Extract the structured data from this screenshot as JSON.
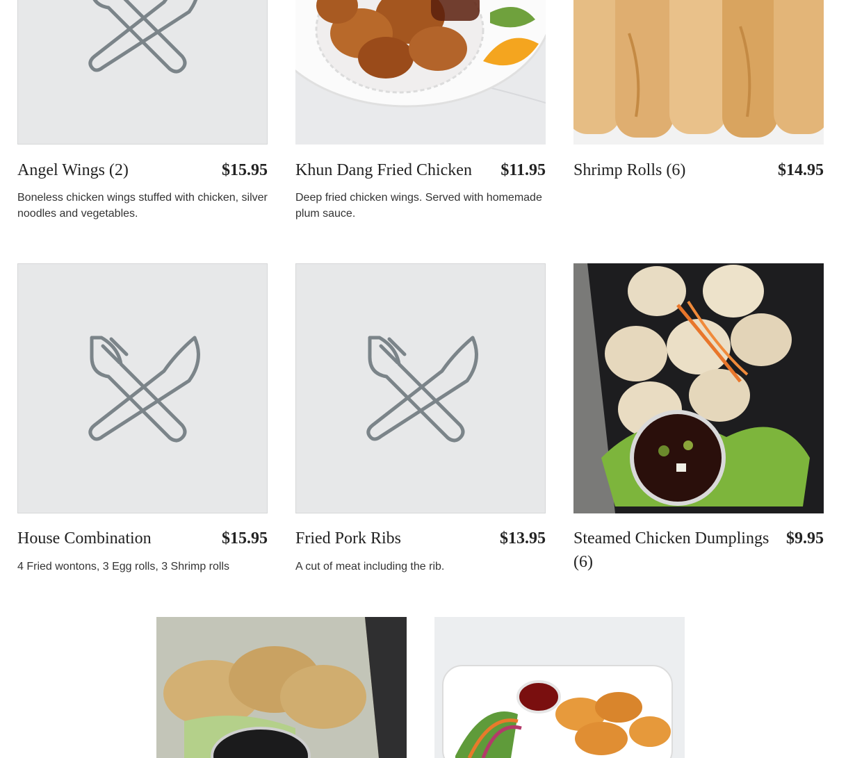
{
  "colors": {
    "placeholder_bg": "#e7e8e9",
    "utensils_icon": "#7b8489",
    "text": "#222222"
  },
  "items": [
    {
      "name": "Angel Wings (2)",
      "price": "$15.95",
      "description": "Boneless chicken wings stuffed with chicken, silver noodles and vegetables.",
      "image": "placeholder-utensils-icon"
    },
    {
      "name": "Khun Dang Fried Chicken",
      "price": "$11.95",
      "description": "Deep fried chicken wings. Served with homemade plum sauce.",
      "image": "fried-chicken-photo"
    },
    {
      "name": "Shrimp Rolls (6)",
      "price": "$14.95",
      "description": "",
      "image": "shrimp-rolls-photo"
    },
    {
      "name": "House Combination",
      "price": "$15.95",
      "description": "4 Fried wontons, 3 Egg rolls, 3 Shrimp rolls",
      "image": "placeholder-utensils-icon"
    },
    {
      "name": "Fried Pork Ribs",
      "price": "$13.95",
      "description": "A cut of meat including the rib.",
      "image": "placeholder-utensils-icon"
    },
    {
      "name": "Steamed Chicken Dumplings (6)",
      "price": "$9.95",
      "description": "",
      "image": "steamed-dumplings-photo"
    },
    {
      "image": "potstickers-photo"
    },
    {
      "image": "fried-wontons-photo"
    }
  ]
}
